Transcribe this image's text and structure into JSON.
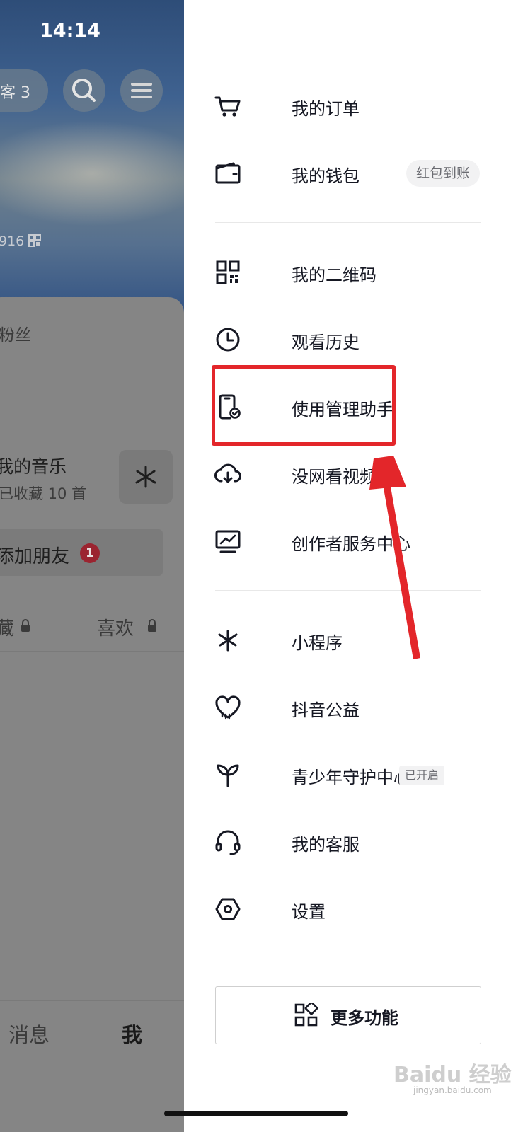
{
  "status_bar": {
    "time": "14:14"
  },
  "profile_background": {
    "visitor_pill": "客 3",
    "id_text": "916 ",
    "fans_label": "粉丝",
    "music_title": "我的音乐",
    "music_sub": "已收藏 10 首",
    "add_friend": "添加朋友",
    "add_friend_badge": "1",
    "tab_collect": "藏",
    "tab_like": "喜欢",
    "nav_messages": "消息",
    "nav_me": "我"
  },
  "drawer": {
    "items": [
      {
        "label": "我的订单",
        "icon": "cart-icon"
      },
      {
        "label": "我的钱包",
        "icon": "wallet-icon",
        "tag": "红包到账"
      },
      {
        "label": "我的二维码",
        "icon": "qr-code-icon"
      },
      {
        "label": "观看历史",
        "icon": "clock-icon"
      },
      {
        "label": "使用管理助手",
        "icon": "phone-check-icon"
      },
      {
        "label": "没网看视频",
        "icon": "cloud-download-icon"
      },
      {
        "label": "创作者服务中心",
        "icon": "monitor-chart-icon"
      },
      {
        "label": "小程序",
        "icon": "mini-program-icon"
      },
      {
        "label": "抖音公益",
        "icon": "heart-icon"
      },
      {
        "label": "青少年守护中心",
        "icon": "sprout-icon",
        "tag": "已开启"
      },
      {
        "label": "我的客服",
        "icon": "headset-icon"
      },
      {
        "label": "设置",
        "icon": "settings-hexagon-icon"
      }
    ],
    "more_button": "更多功能"
  },
  "watermark": {
    "text": "Baidu 经验",
    "sub": "jingyan.baidu.com"
  },
  "colors": {
    "annotation": "#e3262a",
    "badge": "#9b2430",
    "text": "#161823"
  }
}
